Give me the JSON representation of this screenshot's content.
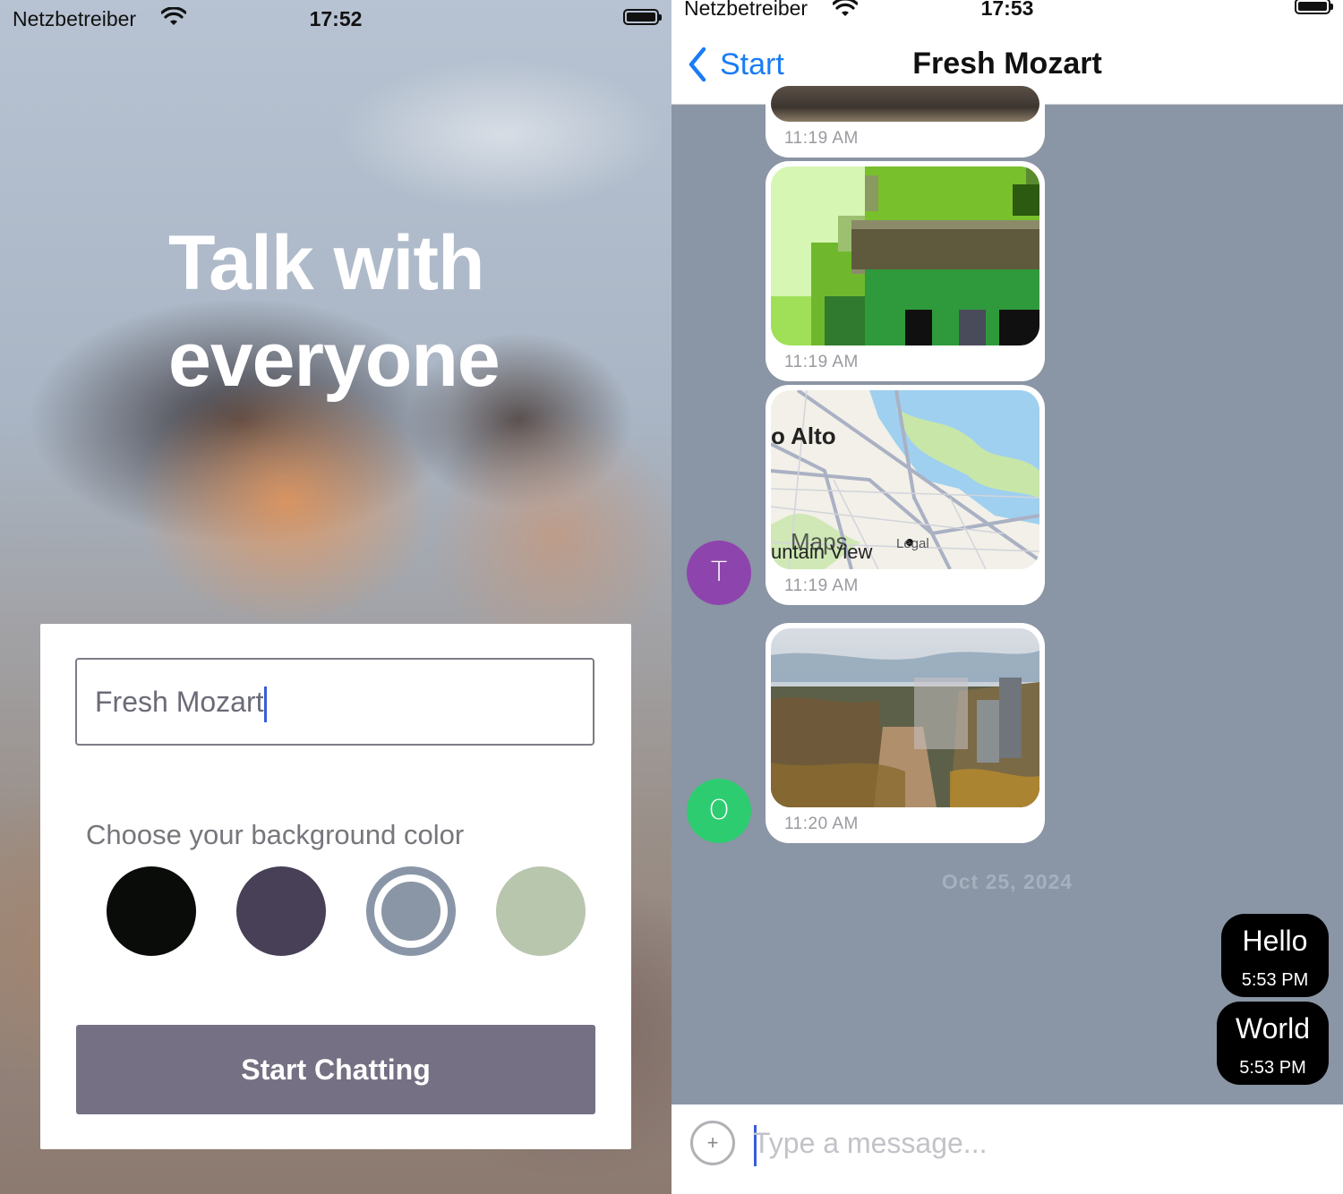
{
  "left": {
    "status": {
      "carrier": "Netzbetreiber",
      "time": "17:52"
    },
    "title_line1": "Talk with",
    "title_line2": "everyone",
    "name_input": {
      "value": "Fresh Mozart"
    },
    "choose_label": "Choose your background color",
    "colors": [
      "#090C08",
      "#474056",
      "#8A95A5",
      "#B9C6AE"
    ],
    "selected_color": "#8A95A5",
    "start_button": "Start Chatting"
  },
  "right": {
    "status": {
      "carrier": "Netzbetreiber",
      "time": "17:53"
    },
    "nav": {
      "back_label": "Start",
      "title": "Fresh Mozart"
    },
    "background_color": "#8A95A5",
    "messages": [
      {
        "type": "image",
        "time": "11:19 AM"
      },
      {
        "type": "image",
        "time": "11:19 AM"
      },
      {
        "type": "location",
        "time": "11:19 AM",
        "map_label_city": "o Alto",
        "map_label_city2": "untain View",
        "map_maps": "Maps",
        "map_legal": "Legal",
        "avatar_letter": "T",
        "avatar_color": "#8e44ad"
      },
      {
        "type": "image",
        "time": "11:20 AM",
        "avatar_letter": "O",
        "avatar_color": "#2ecc71"
      }
    ],
    "date_separator": "Oct 25, 2024",
    "outgoing": [
      {
        "text": "Hello",
        "time": "5:53 PM"
      },
      {
        "text": "World",
        "time": "5:53 PM"
      }
    ],
    "composer": {
      "placeholder": "Type a message...",
      "plus_label": "+"
    }
  }
}
